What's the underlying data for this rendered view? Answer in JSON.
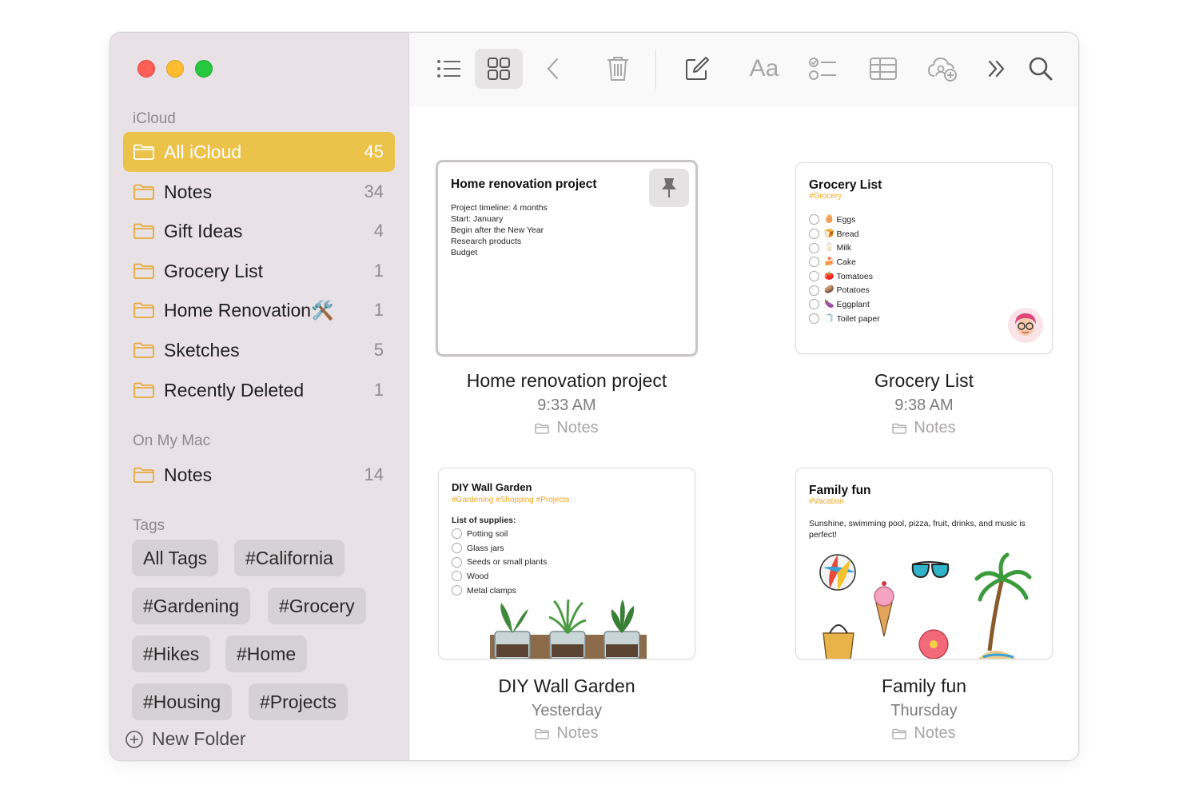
{
  "sidebar": {
    "icloud_label": "iCloud",
    "icloud_folders": [
      {
        "name": "All iCloud",
        "count": "45",
        "selected": true
      },
      {
        "name": "Notes",
        "count": "34"
      },
      {
        "name": "Gift Ideas",
        "count": "4"
      },
      {
        "name": "Grocery List",
        "count": "1"
      },
      {
        "name": "Home Renovation🛠️",
        "count": "1"
      },
      {
        "name": "Sketches",
        "count": "5"
      },
      {
        "name": "Recently Deleted",
        "count": "1"
      }
    ],
    "mac_label": "On My Mac",
    "mac_folders": [
      {
        "name": "Notes",
        "count": "14"
      }
    ],
    "tags_label": "Tags",
    "tags": [
      "All Tags",
      "#California",
      "#Gardening",
      "#Grocery",
      "#Hikes",
      "#Home",
      "#Housing",
      "#Projects"
    ],
    "new_folder_label": "New Folder"
  },
  "toolbar": {
    "icons": [
      "list-view-icon",
      "gallery-view-icon",
      "back-icon",
      "trash-icon",
      "compose-icon",
      "format-text-icon",
      "checklist-icon",
      "table-icon",
      "collaborate-icon",
      "more-icon",
      "search-icon"
    ],
    "format_label": "Aa"
  },
  "notes": [
    {
      "card_title": "Home renovation project",
      "body_lines": [
        "Project timeline: 4 months",
        "Start: January",
        "Begin after the New Year",
        "Research products",
        "Budget"
      ],
      "title": "Home renovation project",
      "time": "9:33 AM",
      "folder": "Notes"
    },
    {
      "card_title": "Grocery List",
      "tag_line": "#Grocery",
      "items": [
        {
          "emoji": "🥚",
          "label": "Eggs"
        },
        {
          "emoji": "🍞",
          "label": "Bread"
        },
        {
          "emoji": "🥛",
          "label": "Milk"
        },
        {
          "emoji": "🍰",
          "label": "Cake"
        },
        {
          "emoji": "🍅",
          "label": "Tomatoes"
        },
        {
          "emoji": "🥔",
          "label": "Potatoes"
        },
        {
          "emoji": "🍆",
          "label": "Eggplant"
        },
        {
          "emoji": "🧻",
          "label": "Toilet paper"
        }
      ],
      "title": "Grocery List",
      "time": "9:38 AM",
      "folder": "Notes"
    },
    {
      "card_title": "DIY Wall Garden",
      "tag_line": "#Gardening #Shopping #Projects",
      "subheading": "List of supplies:",
      "items": [
        "Potting soil",
        "Glass jars",
        "Seeds or small plants",
        "Wood",
        "Metal clamps"
      ],
      "title": "DIY Wall Garden",
      "time": "Yesterday",
      "folder": "Notes"
    },
    {
      "card_title": "Family fun",
      "tag_line": "#Vacation",
      "body": "Sunshine, swimming pool, pizza, fruit, drinks, and music is perfect!",
      "title": "Family fun",
      "time": "Thursday",
      "folder": "Notes"
    }
  ],
  "colors": {
    "accent_selected": "#ecc34a",
    "folder_icon": "#e8a83a",
    "tag_text": "#f5a623",
    "sidebar_bg": "#e8e2e6"
  }
}
